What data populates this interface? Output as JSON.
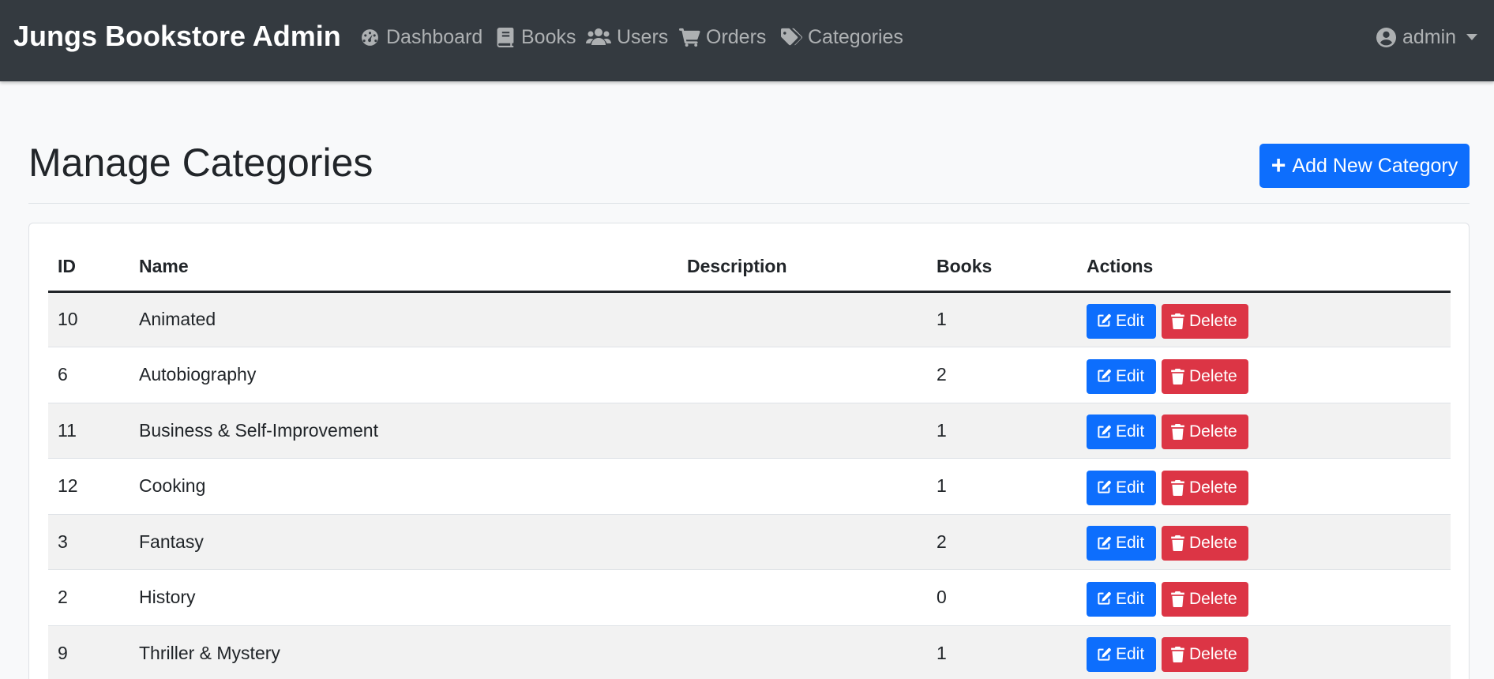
{
  "navbar": {
    "brand": "Jungs Bookstore Admin",
    "items": [
      {
        "label": "Dashboard",
        "icon": "dashboard-icon"
      },
      {
        "label": "Books",
        "icon": "book-icon"
      },
      {
        "label": "Users",
        "icon": "users-icon"
      },
      {
        "label": "Orders",
        "icon": "cart-icon"
      },
      {
        "label": "Categories",
        "icon": "tags-icon"
      }
    ],
    "user": {
      "label": "admin",
      "icon": "user-circle-icon"
    }
  },
  "page": {
    "title": "Manage Categories",
    "add_button": "Add New Category"
  },
  "table": {
    "headers": {
      "id": "ID",
      "name": "Name",
      "description": "Description",
      "books": "Books",
      "actions": "Actions"
    },
    "edit_label": "Edit",
    "delete_label": "Delete",
    "rows": [
      {
        "id": "10",
        "name": "Animated",
        "description": "",
        "books": "1"
      },
      {
        "id": "6",
        "name": "Autobiography",
        "description": "",
        "books": "2"
      },
      {
        "id": "11",
        "name": "Business & Self-Improvement",
        "description": "",
        "books": "1"
      },
      {
        "id": "12",
        "name": "Cooking",
        "description": "",
        "books": "1"
      },
      {
        "id": "3",
        "name": "Fantasy",
        "description": "",
        "books": "2"
      },
      {
        "id": "2",
        "name": "History",
        "description": "",
        "books": "0"
      },
      {
        "id": "9",
        "name": "Thriller & Mystery",
        "description": "",
        "books": "1"
      }
    ]
  },
  "colors": {
    "navbar": "#343a40",
    "primary": "#0d6efd",
    "danger": "#dc3545",
    "background": "#f8f9fa"
  }
}
